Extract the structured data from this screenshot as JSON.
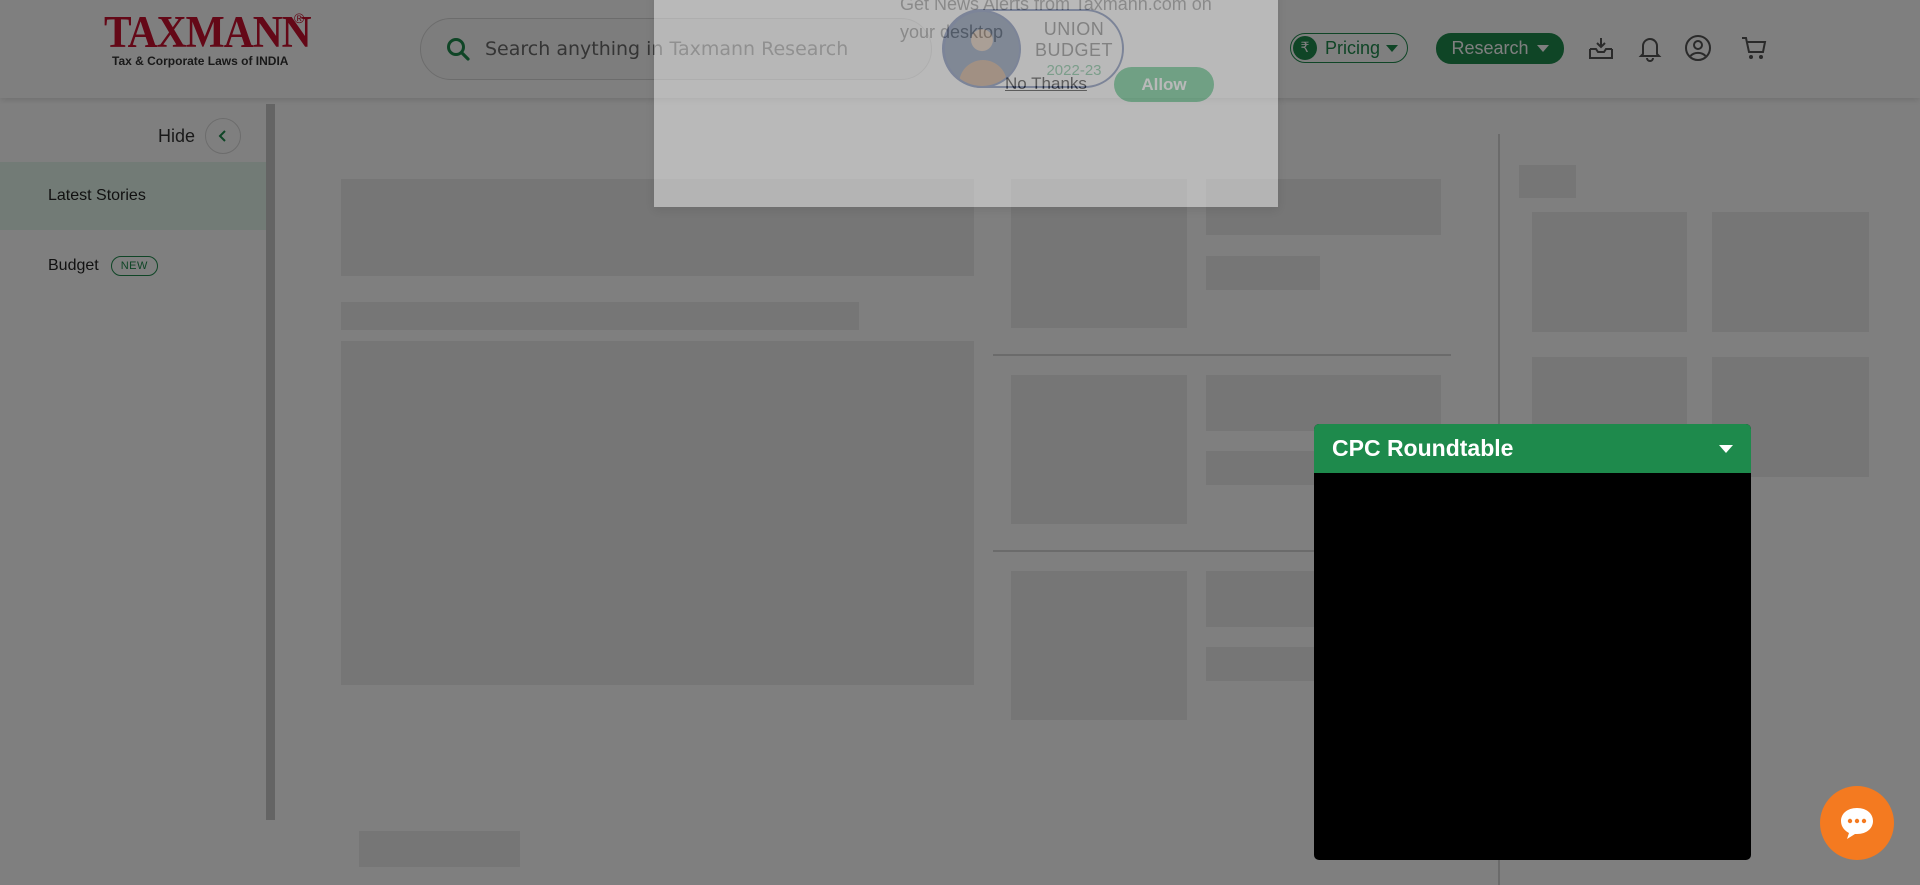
{
  "header": {
    "logo": {
      "word": "TAXMANN",
      "reg": "®",
      "tagline": "Tax & Corporate Laws of INDIA"
    },
    "search": {
      "placeholder": "Search anything in Taxmann Research",
      "icon": "search-icon"
    },
    "budget": {
      "line1": "UNION",
      "line2": "BUDGET",
      "year": "2022-23"
    },
    "pricing": {
      "label": "Pricing",
      "icon": "rupee-icon"
    },
    "research": {
      "label": "Research"
    },
    "icons": [
      "inbox-icon",
      "bell-icon",
      "user-icon",
      "cart-icon"
    ]
  },
  "sidebar": {
    "hide_label": "Hide",
    "items": [
      {
        "label": "Latest Stories",
        "active": true
      },
      {
        "label": "Budget",
        "badge": "NEW"
      }
    ]
  },
  "notification": {
    "text": "Get News Alerts from Taxmann.com on your desktop",
    "no_label": "No Thanks",
    "allow_label": "Allow"
  },
  "video_widget": {
    "title": "CPC Roundtable"
  },
  "colors": {
    "brand_red": "#c8102e",
    "brand_green": "#1e8a4c",
    "chat_orange": "#f47a20",
    "overlay": "rgba(0,0,0,0.5)"
  }
}
